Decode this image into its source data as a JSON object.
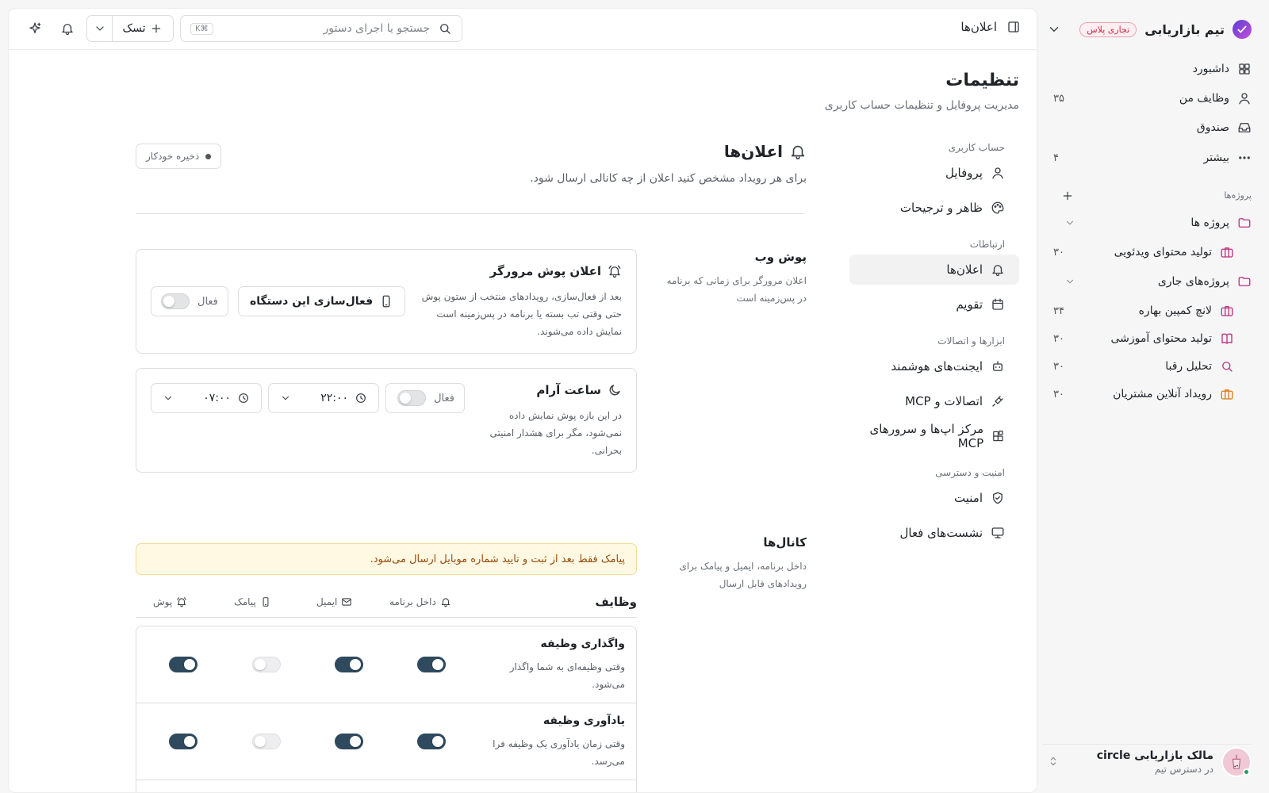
{
  "sidebar": {
    "team_name": "تیم بازاریابی",
    "plan_badge": "تجاری پلاس",
    "nav": [
      {
        "label": "داشبورد",
        "icon": "grid-icon",
        "count": ""
      },
      {
        "label": "وظایف من",
        "icon": "user-icon",
        "count": "۳۵"
      },
      {
        "label": "صندوق",
        "icon": "inbox-icon",
        "count": ""
      },
      {
        "label": "بیشتر",
        "icon": "dots-icon",
        "count": "۴"
      }
    ],
    "projects_title": "پروژه‌ها",
    "projects": [
      {
        "label": "پروژه ها",
        "icon": "folder-icon",
        "count": "",
        "type": "folder"
      },
      {
        "label": "تولید محتوای ویدئویی",
        "icon": "briefcase-icon",
        "count": "۳۰",
        "type": "child"
      },
      {
        "label": "پروژه‌های جاری",
        "icon": "folder-icon",
        "count": "",
        "type": "folder"
      },
      {
        "label": "لانچ کمپین بهاره",
        "icon": "briefcase-icon",
        "count": "۳۴",
        "type": "child"
      },
      {
        "label": "تولید محتوای آموزشی",
        "icon": "book-icon",
        "count": "۳۰",
        "type": "child"
      },
      {
        "label": "تحلیل رقبا",
        "icon": "search-icon",
        "count": "۳۰",
        "type": "child"
      },
      {
        "label": "رویداد آنلاین مشتریان",
        "icon": "briefcase-icon",
        "count": "۳۰",
        "type": "child"
      }
    ],
    "user": {
      "name": "مالک بازاریابی circle",
      "role": "در دسترس تیم"
    }
  },
  "topbar": {
    "title": "اعلان‌ها",
    "search_placeholder": "جستجو یا اجرای دستور",
    "search_shortcut": "⌘K",
    "task_label": "تسک"
  },
  "page": {
    "title": "تنظیمات",
    "subtitle": "مدیریت پروفایل و تنظیمات حساب کاربری"
  },
  "settings_nav": {
    "sections": [
      {
        "title": "حساب کاربری",
        "items": [
          {
            "label": "پروفایل",
            "icon": "user-icon",
            "active": false
          },
          {
            "label": "ظاهر و ترجیحات",
            "icon": "palette-icon",
            "active": false
          }
        ]
      },
      {
        "title": "ارتباطات",
        "items": [
          {
            "label": "اعلان‌ها",
            "icon": "bell-icon",
            "active": true
          },
          {
            "label": "تقویم",
            "icon": "calendar-icon",
            "active": false
          }
        ]
      },
      {
        "title": "ابزارها و اتصالات",
        "items": [
          {
            "label": "ایجنت‌های هوشمند",
            "icon": "bot-icon",
            "active": false
          },
          {
            "label": "اتصالات و MCP",
            "icon": "plug-icon",
            "active": false
          },
          {
            "label": "مرکز اپ‌ها و سرورهای MCP",
            "icon": "apps-icon",
            "active": false
          }
        ]
      },
      {
        "title": "امنیت و دسترسی",
        "items": [
          {
            "label": "امنیت",
            "icon": "shield-icon",
            "active": false
          },
          {
            "label": "نشست‌های فعال",
            "icon": "monitor-icon",
            "active": false
          }
        ]
      }
    ]
  },
  "content": {
    "title": "اعلان‌ها",
    "description": "برای هر رویداد مشخص کنید اعلان از چه کانالی ارسال شود.",
    "autosave": "ذخیره خودکار",
    "push": {
      "title": "پوش وب",
      "description": "اعلان مرورگر برای زمانی که برنامه در پس‌زمینه است",
      "browser_card": {
        "title": "اعلان پوش مرورگر",
        "lines": [
          "بعد از فعال‌سازی، رویدادهای منتخب از ستون پوش",
          "حتی وقتی تب بسته یا برنامه در پس‌زمینه است",
          "نمایش داده می‌شوند."
        ],
        "activate_label": "فعال‌سازی این دستگاه",
        "toggle_label": "فعال",
        "toggle_on": false
      },
      "quiet_card": {
        "title": "ساعت آرام",
        "lines": [
          "در این بازه پوش نمایش داده",
          "نمی‌شود، مگر برای هشدار امنیتی",
          "بحرانی."
        ],
        "toggle_label": "فعال",
        "toggle_on": false,
        "from": "۲۲:۰۰",
        "to": "۰۷:۰۰"
      }
    },
    "channels": {
      "title": "کانال‌ها",
      "description": "داخل برنامه، ایمیل و پیامک برای رویدادهای قابل ارسال",
      "alert": "پیامک فقط بعد از ثبت و تایید شماره موبایل ارسال می‌شود.",
      "group_title": "وظایف",
      "columns": [
        "داخل برنامه",
        "ایمیل",
        "پیامک",
        "پوش"
      ],
      "rows": [
        {
          "title": "واگذاری وظیفه",
          "lines": [
            "وقتی وظیفه‌ای به شما واگذار",
            "می‌شود."
          ],
          "toggles": [
            true,
            true,
            false,
            true
          ]
        },
        {
          "title": "یادآوری وظیفه",
          "lines": [
            "وقتی زمان یادآوری یک وظیفه فرا",
            "می‌رسد."
          ],
          "toggles": [
            true,
            true,
            false,
            true
          ]
        }
      ]
    }
  },
  "colors": {
    "accent": "#2f4a5e",
    "badge": "#c4314b",
    "alert_bg": "#fff9e4"
  }
}
